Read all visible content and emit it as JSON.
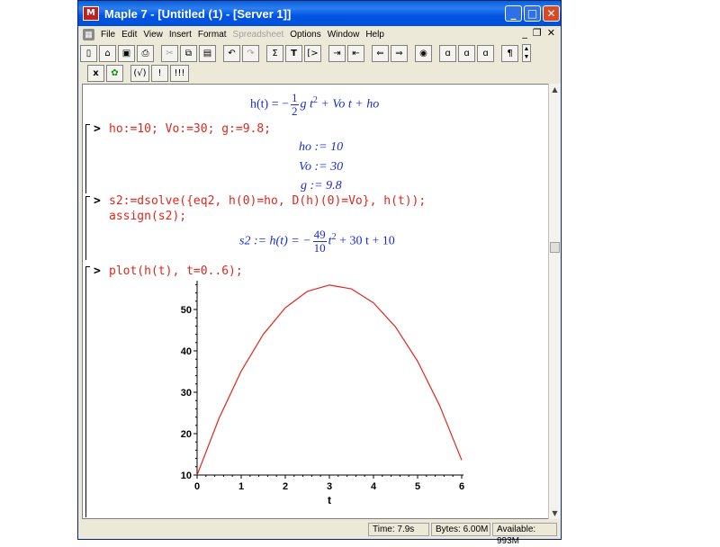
{
  "window": {
    "title": "Maple 7 - [Untitled (1) - [Server 1]]",
    "app_icon": "maple-logo-icon"
  },
  "menu": {
    "items": [
      "File",
      "Edit",
      "View",
      "Insert",
      "Format",
      "Spreadsheet",
      "Options",
      "Window",
      "Help"
    ],
    "disabled": [
      "Spreadsheet"
    ]
  },
  "toolbar": {
    "buttons": [
      "new-file-icon",
      "open-folder-icon",
      "save-icon",
      "print-icon",
      "cut-icon",
      "copy-icon",
      "paste-icon",
      "undo-icon",
      "redo-icon",
      "sigma-icon",
      "text-T-icon",
      "insert-prompt-icon",
      "indent-icon",
      "outdent-icon",
      "back-arrow-icon",
      "forward-arrow-icon",
      "stop-icon",
      "zoom-small-icon",
      "zoom-medium-icon",
      "zoom-large-icon",
      "pilcrow-icon"
    ],
    "row2": [
      "x",
      "✿",
      "(√)",
      "!",
      "!!!"
    ]
  },
  "worksheet": {
    "equation1": {
      "lhs": "h(t) = −",
      "frac_num": "1",
      "frac_den": "2",
      "rhs_part1": "g t",
      "exp": "2",
      "rhs_part2": "+ Vo t + ho"
    },
    "input1": "ho:=10; Vo:=30; g:=9.8;",
    "outputs1": [
      "ho := 10",
      "Vo := 30",
      "g := 9.8"
    ],
    "input2_line1": "s2:=dsolve({eq2, h(0)=ho, D(h)(0)=Vo}, h(t));",
    "input2_line2": "assign(s2);",
    "equation2": {
      "lhs": "s2 := h(t) = −",
      "frac_num": "49",
      "frac_den": "10",
      "var": "t",
      "exp": "2",
      "rest": "+ 30 t + 10"
    },
    "input3": "plot(h(t), t=0..6);",
    "prompt_symbol": ">"
  },
  "chart_data": {
    "type": "line",
    "xlabel": "t",
    "ylabel": "",
    "xlim": [
      0,
      6
    ],
    "ylim": [
      10,
      56
    ],
    "x_ticks": [
      "0",
      "1",
      "2",
      "3",
      "4",
      "5",
      "6"
    ],
    "y_ticks": [
      "10",
      "20",
      "30",
      "40",
      "50"
    ],
    "series": [
      {
        "color": "#e0261c",
        "x": [
          0,
          0.5,
          1,
          1.5,
          2,
          2.5,
          3,
          3.5,
          4,
          4.5,
          5,
          5.5,
          6
        ],
        "y": [
          10,
          23.78,
          35.1,
          43.98,
          50.4,
          54.38,
          55.9,
          54.98,
          51.6,
          45.78,
          37.5,
          26.78,
          13.6
        ]
      }
    ]
  },
  "status": {
    "time": "Time:   7.9s",
    "bytes": "Bytes: 6.00M",
    "available": "Available: 993M"
  },
  "colors": {
    "input": "#e0261c",
    "output": "#1a2bd4",
    "titlebar": "#0054e3"
  }
}
